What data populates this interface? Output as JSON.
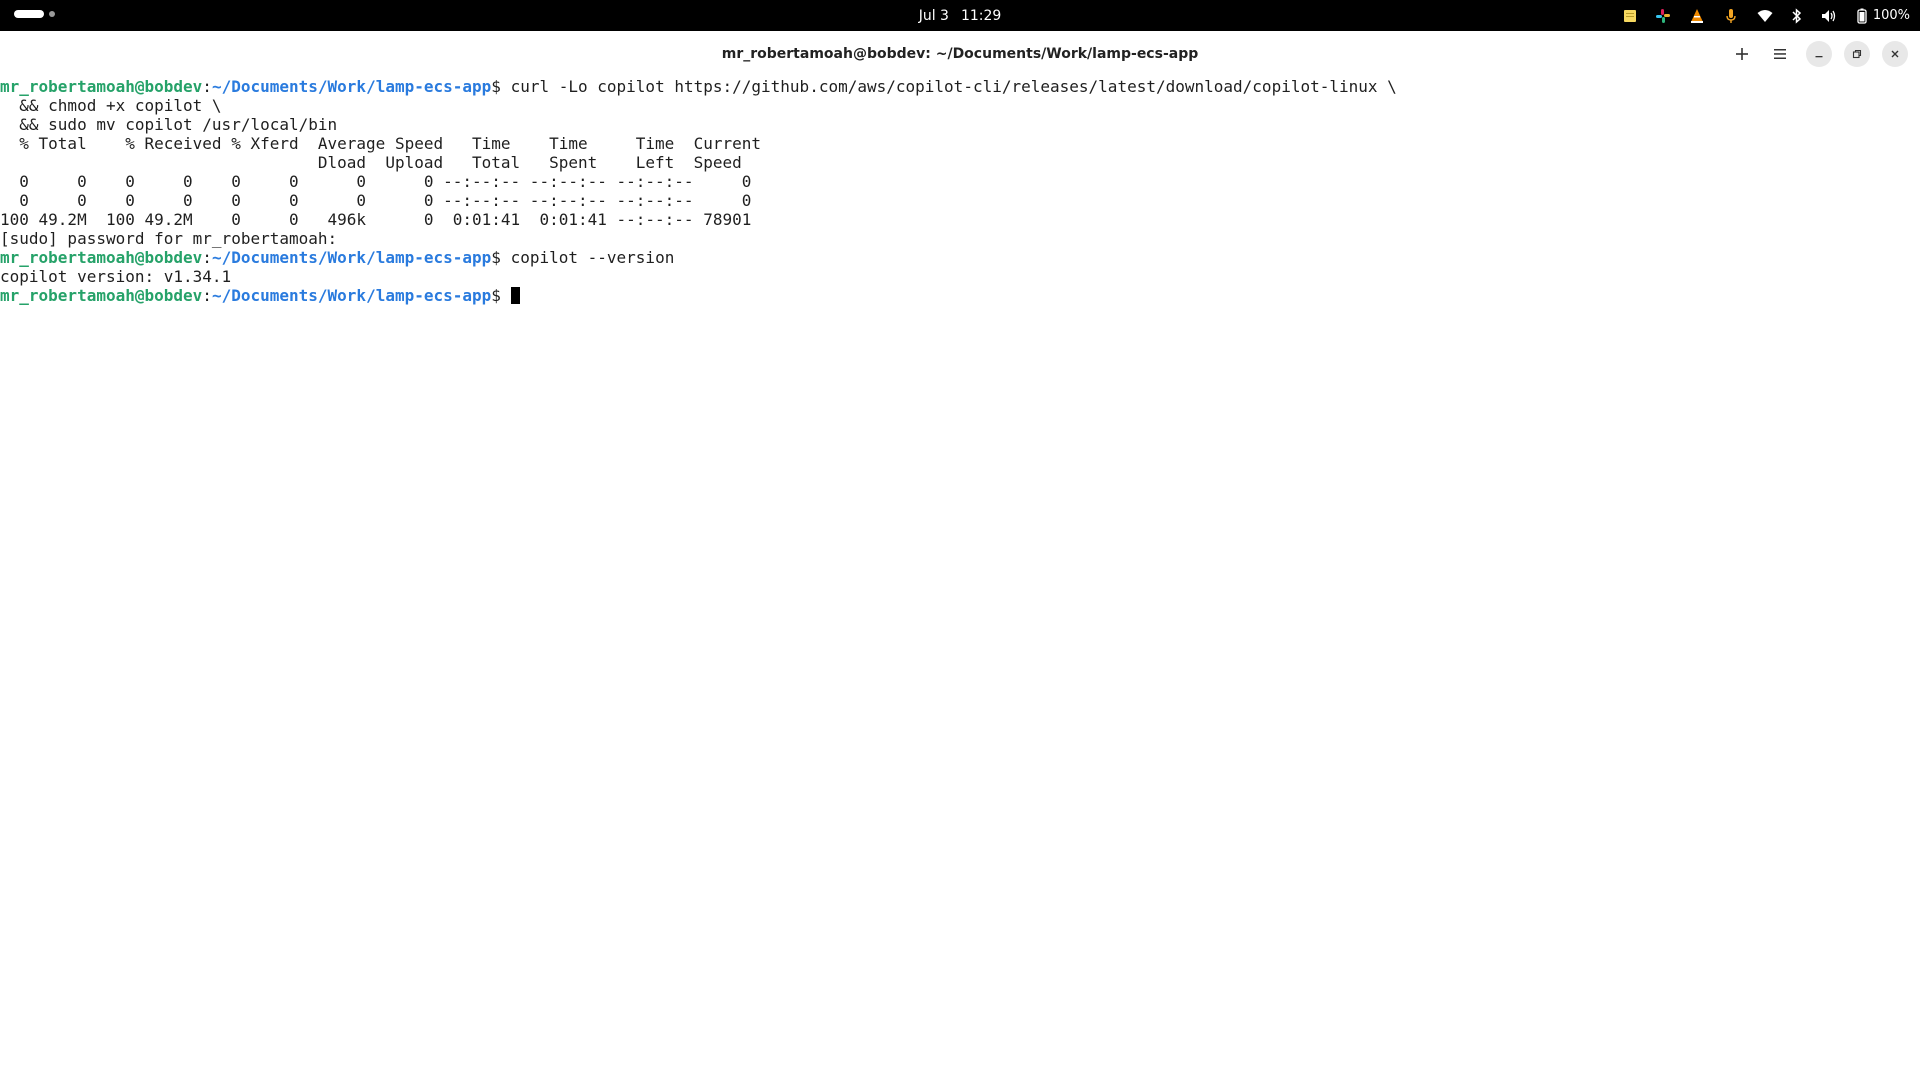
{
  "topbar": {
    "date": "Jul 3",
    "time": "11:29",
    "battery_percent": "100%",
    "tray_icons": [
      "sticky-notes-icon",
      "slack-icon",
      "vlc-icon",
      "microphone-icon",
      "wifi-icon",
      "bluetooth-icon",
      "volume-icon",
      "battery-icon"
    ]
  },
  "window": {
    "title": "mr_robertamoah@bobdev: ~/Documents/Work/lamp-ecs-app",
    "buttons": [
      "new-tab",
      "menu",
      "minimize",
      "restore",
      "close"
    ]
  },
  "prompt": {
    "user_host": "mr_robertamoah@bobdev",
    "sep": ":",
    "path": "~/Documents/Work/lamp-ecs-app",
    "symbol": "$"
  },
  "terminal": {
    "cmd1": " curl -Lo copilot https://github.com/aws/copilot-cli/releases/latest/download/copilot-linux \\",
    "cmd1_cont1": "  && chmod +x copilot \\",
    "cmd1_cont2": "  && sudo mv copilot /usr/local/bin",
    "curl_header1": "  % Total    % Received % Xferd  Average Speed   Time    Time     Time  Current",
    "curl_header2": "                                 Dload  Upload   Total   Spent    Left  Speed",
    "curl_row1": "  0     0    0     0    0     0      0      0 --:--:-- --:--:-- --:--:--     0",
    "curl_row2": "  0     0    0     0    0     0      0      0 --:--:-- --:--:-- --:--:--     0",
    "curl_row3": "100 49.2M  100 49.2M    0     0   496k      0  0:01:41  0:01:41 --:--:-- 78901",
    "sudo_prompt": "[sudo] password for mr_robertamoah:",
    "cmd2": " copilot --version",
    "version_output": "copilot version: v1.34.1",
    "cmd3": " "
  }
}
